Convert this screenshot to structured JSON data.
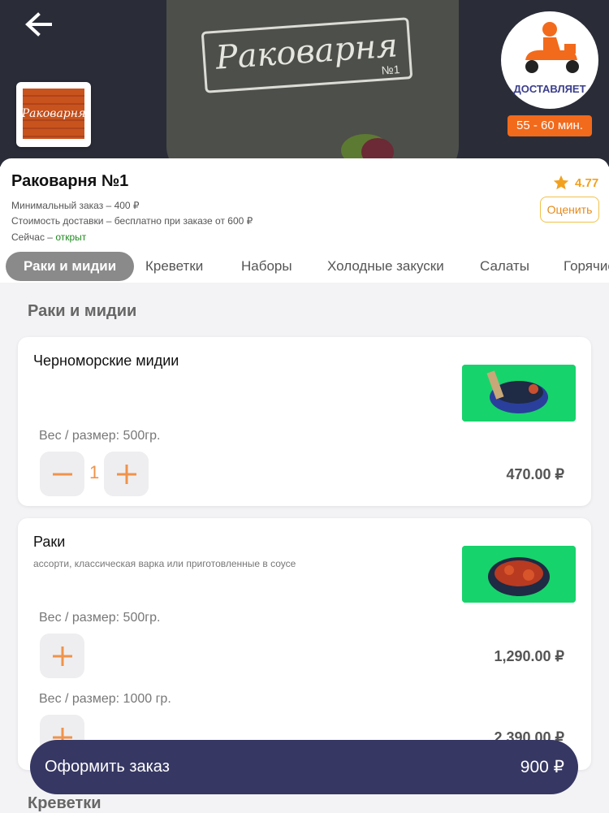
{
  "header": {
    "apron_logo": "Раковарня",
    "apron_number": "№1",
    "logo_text": "Раковарня",
    "delivery_badge_label": "ДОСТАВЛЯЕТ",
    "delivery_time": "55 - 60 мин."
  },
  "restaurant": {
    "name": "Раковарня №1",
    "min_order": "Минимальный заказ – 400 ₽",
    "delivery_cost": "Стоимость доставки – бесплатно при заказе от 600 ₽",
    "status_prefix": "Сейчас – ",
    "status_value": "открыт",
    "rating": "4.77",
    "rate_button": "Оценить"
  },
  "tabs": [
    {
      "label": "Раки и мидии",
      "active": true
    },
    {
      "label": "Креветки"
    },
    {
      "label": "Наборы"
    },
    {
      "label": "Холодные закуски"
    },
    {
      "label": "Салаты"
    },
    {
      "label": "Горячие"
    }
  ],
  "menu": {
    "section_title": "Раки и мидии",
    "next_section_title": "Креветки",
    "items": [
      {
        "name": "Черноморские мидии",
        "description": "",
        "variants": [
          {
            "weight": "Вес / размер: 500гр.",
            "price": "470.00 ₽",
            "quantity": "1"
          }
        ]
      },
      {
        "name": "Раки",
        "description": "ассорти, классическая варка или приготовленные в соусе",
        "variants": [
          {
            "weight": "Вес / размер: 500гр.",
            "price": "1,290.00 ₽"
          },
          {
            "weight": "Вес / размер: 1000 гр.",
            "price": "2,390.00 ₽"
          }
        ]
      }
    ]
  },
  "order_bar": {
    "label": "Оформить заказ",
    "total": "900 ₽"
  },
  "colors": {
    "accent": "#f26a1b",
    "order_bar": "#363763",
    "rating": "#f2a11f",
    "stepper": "#f0934a",
    "open_status": "#1f8a1f"
  },
  "icons": [
    "back-arrow-icon",
    "star-icon",
    "minus-icon",
    "plus-icon",
    "scooter-icon"
  ]
}
